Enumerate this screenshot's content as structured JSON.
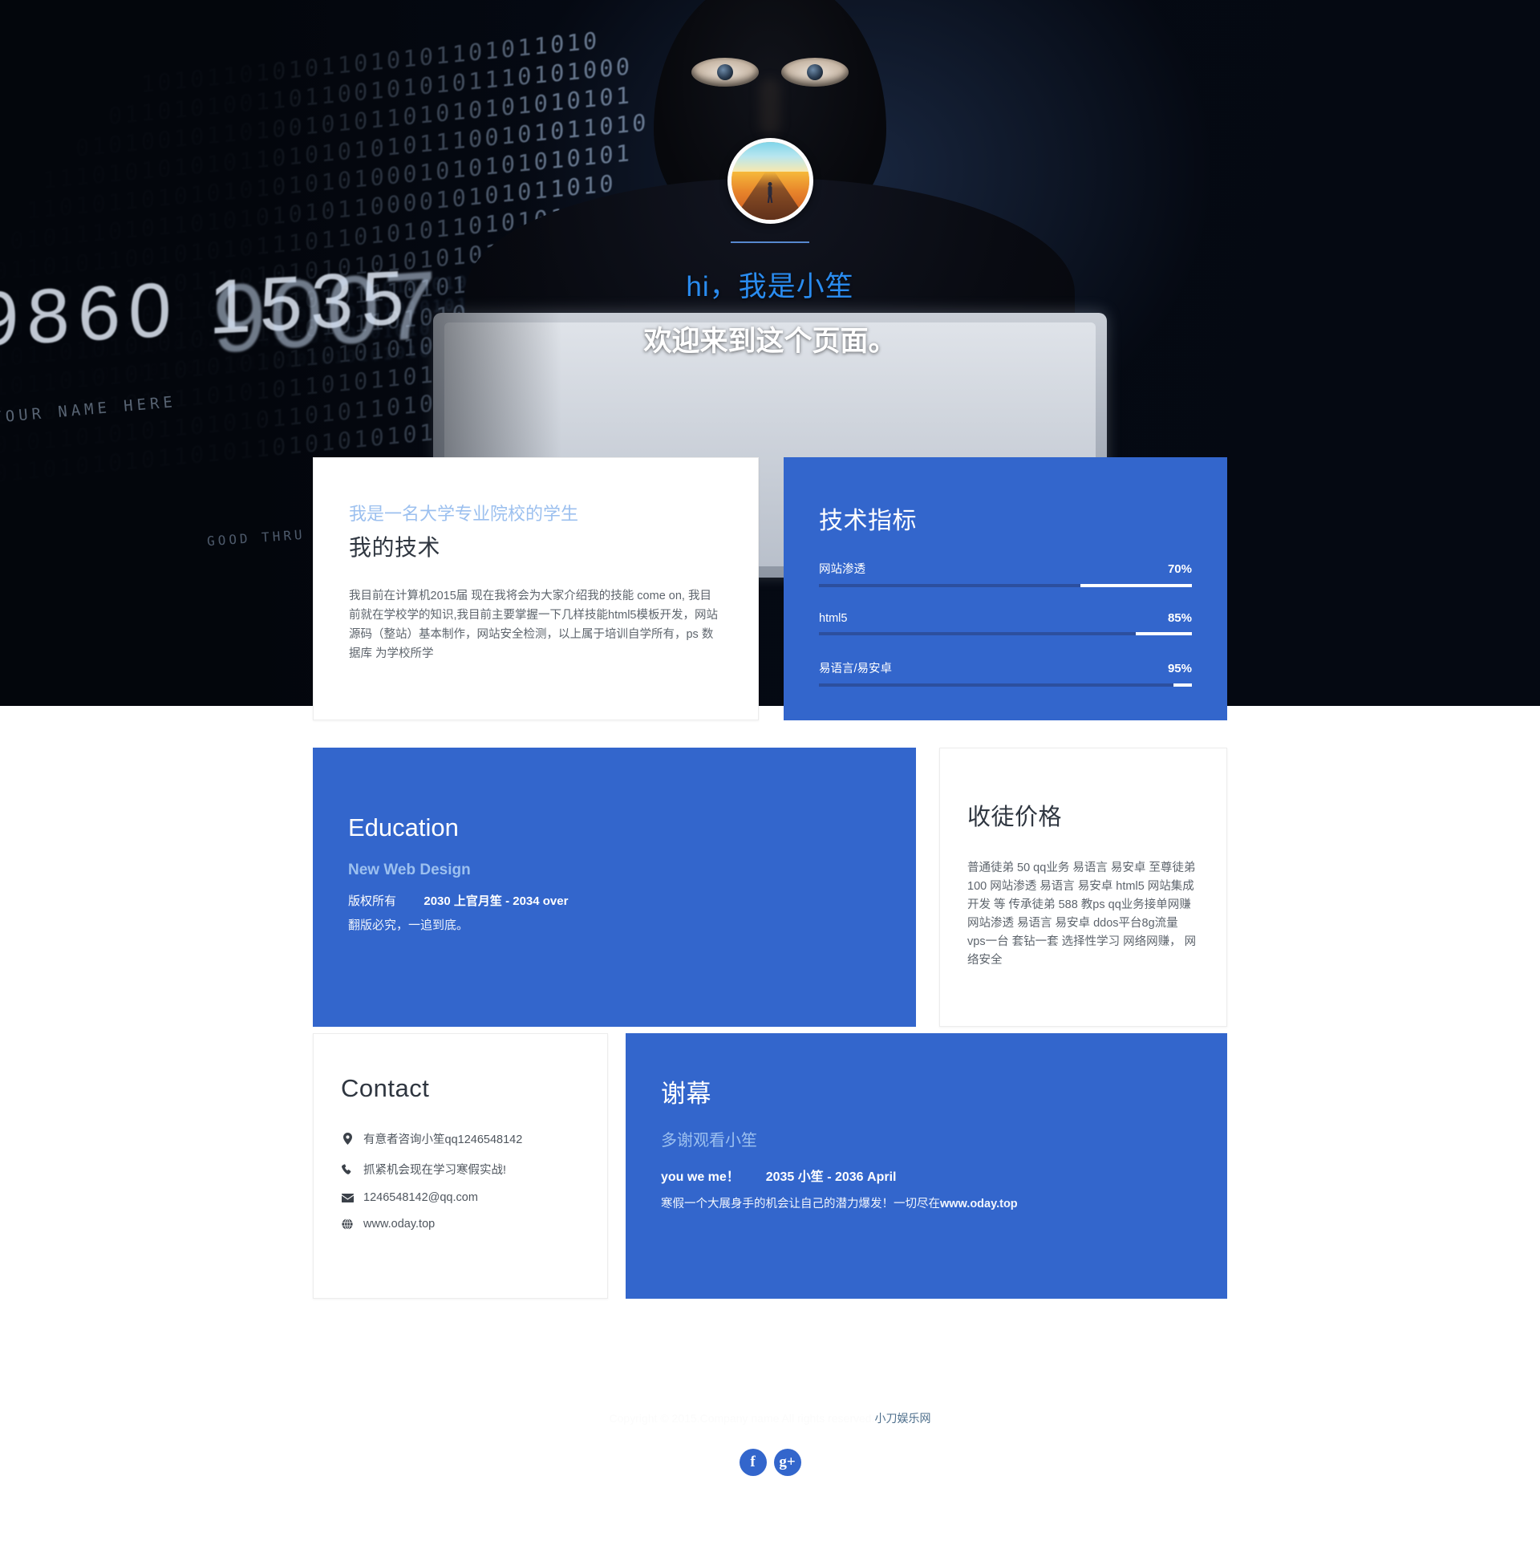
{
  "hero": {
    "avatar_alt": "avatar-runner-on-road",
    "title": "hi，我是小笙",
    "subtitle": "欢迎来到这个页面。",
    "background_alt": "hacker-binary-code-background"
  },
  "skills_card": {
    "kicker": "我是一名大学专业院校的学生",
    "heading": "我的技术",
    "body": "我目前在计算机2015届 现在我将会为大家介绍我的技能 come on, 我目前就在学校学的知识,我目前主要掌握一下几样技能html5模板开发，网站源码（整站）基本制作，网站安全检测，以上属于培训自学所有，ps 数据库 为学校所学"
  },
  "metrics_card": {
    "heading": "技术指标",
    "items": [
      {
        "label": "网站渗透",
        "percent": "70%",
        "value": 70
      },
      {
        "label": "html5",
        "percent": "85%",
        "value": 85
      },
      {
        "label": "易语言/易安卓",
        "percent": "95%",
        "value": 95
      }
    ]
  },
  "education_card": {
    "heading": "Education",
    "subheading": "New Web Design",
    "line1_prefix": "版权所有",
    "line1_main": "2030 上官月笙 - 2034 over",
    "line2": "翻版必究，一追到底。"
  },
  "pricing_card": {
    "heading": "收徒价格",
    "body": "普通徒弟 50 qq业务 易语言 易安卓 至尊徒弟 100 网站渗透 易语言 易安卓 html5 网站集成开发 等 传承徒弟 588 教ps qq业务接单网赚 网站渗透 易语言 易安卓 ddos平台8g流量 vps一台 套钻一套 选择性学习 网络网赚， 网络安全"
  },
  "contact_card": {
    "heading": "Contact",
    "rows": [
      {
        "icon": "map-pin-icon",
        "text": "有意者咨询小笙qq1246548142"
      },
      {
        "icon": "phone-icon",
        "text": "抓紧机会现在学习寒假实战!"
      },
      {
        "icon": "envelope-icon",
        "text": "1246548142@qq.com"
      },
      {
        "icon": "globe-icon",
        "text": "www.oday.top"
      }
    ]
  },
  "thanks_card": {
    "heading": "谢幕",
    "subheading": "多谢观看小笙",
    "line1_prefix": "you we me！",
    "line1_main": "2035 小笙 - 2036 April",
    "line2_text": "寒假一个大展身手的机会让自己的潜力爆发！一切尽在",
    "line2_link": "www.oday.top"
  },
  "footer": {
    "copyright": "Copyright © 2015.Company name All rights reserved.",
    "site_name": "小刀娱乐网",
    "social": [
      {
        "icon": "facebook-icon",
        "glyph": "f"
      },
      {
        "icon": "google-plus-icon",
        "glyph": "g+"
      }
    ]
  },
  "theme": {
    "accent_blue": "#3366cc",
    "light_blue": "#9cc0ef",
    "hero_title_blue": "#2a8cf0",
    "bar_fill": "#2c4f9e"
  }
}
